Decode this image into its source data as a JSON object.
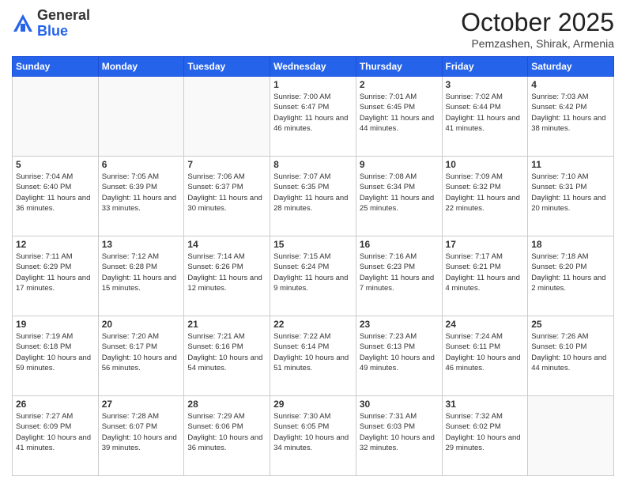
{
  "header": {
    "logo_general": "General",
    "logo_blue": "Blue",
    "month_title": "October 2025",
    "location": "Pemzashen, Shirak, Armenia"
  },
  "days_of_week": [
    "Sunday",
    "Monday",
    "Tuesday",
    "Wednesday",
    "Thursday",
    "Friday",
    "Saturday"
  ],
  "weeks": [
    [
      {
        "day": "",
        "info": ""
      },
      {
        "day": "",
        "info": ""
      },
      {
        "day": "",
        "info": ""
      },
      {
        "day": "1",
        "info": "Sunrise: 7:00 AM\nSunset: 6:47 PM\nDaylight: 11 hours and 46 minutes."
      },
      {
        "day": "2",
        "info": "Sunrise: 7:01 AM\nSunset: 6:45 PM\nDaylight: 11 hours and 44 minutes."
      },
      {
        "day": "3",
        "info": "Sunrise: 7:02 AM\nSunset: 6:44 PM\nDaylight: 11 hours and 41 minutes."
      },
      {
        "day": "4",
        "info": "Sunrise: 7:03 AM\nSunset: 6:42 PM\nDaylight: 11 hours and 38 minutes."
      }
    ],
    [
      {
        "day": "5",
        "info": "Sunrise: 7:04 AM\nSunset: 6:40 PM\nDaylight: 11 hours and 36 minutes."
      },
      {
        "day": "6",
        "info": "Sunrise: 7:05 AM\nSunset: 6:39 PM\nDaylight: 11 hours and 33 minutes."
      },
      {
        "day": "7",
        "info": "Sunrise: 7:06 AM\nSunset: 6:37 PM\nDaylight: 11 hours and 30 minutes."
      },
      {
        "day": "8",
        "info": "Sunrise: 7:07 AM\nSunset: 6:35 PM\nDaylight: 11 hours and 28 minutes."
      },
      {
        "day": "9",
        "info": "Sunrise: 7:08 AM\nSunset: 6:34 PM\nDaylight: 11 hours and 25 minutes."
      },
      {
        "day": "10",
        "info": "Sunrise: 7:09 AM\nSunset: 6:32 PM\nDaylight: 11 hours and 22 minutes."
      },
      {
        "day": "11",
        "info": "Sunrise: 7:10 AM\nSunset: 6:31 PM\nDaylight: 11 hours and 20 minutes."
      }
    ],
    [
      {
        "day": "12",
        "info": "Sunrise: 7:11 AM\nSunset: 6:29 PM\nDaylight: 11 hours and 17 minutes."
      },
      {
        "day": "13",
        "info": "Sunrise: 7:12 AM\nSunset: 6:28 PM\nDaylight: 11 hours and 15 minutes."
      },
      {
        "day": "14",
        "info": "Sunrise: 7:14 AM\nSunset: 6:26 PM\nDaylight: 11 hours and 12 minutes."
      },
      {
        "day": "15",
        "info": "Sunrise: 7:15 AM\nSunset: 6:24 PM\nDaylight: 11 hours and 9 minutes."
      },
      {
        "day": "16",
        "info": "Sunrise: 7:16 AM\nSunset: 6:23 PM\nDaylight: 11 hours and 7 minutes."
      },
      {
        "day": "17",
        "info": "Sunrise: 7:17 AM\nSunset: 6:21 PM\nDaylight: 11 hours and 4 minutes."
      },
      {
        "day": "18",
        "info": "Sunrise: 7:18 AM\nSunset: 6:20 PM\nDaylight: 11 hours and 2 minutes."
      }
    ],
    [
      {
        "day": "19",
        "info": "Sunrise: 7:19 AM\nSunset: 6:18 PM\nDaylight: 10 hours and 59 minutes."
      },
      {
        "day": "20",
        "info": "Sunrise: 7:20 AM\nSunset: 6:17 PM\nDaylight: 10 hours and 56 minutes."
      },
      {
        "day": "21",
        "info": "Sunrise: 7:21 AM\nSunset: 6:16 PM\nDaylight: 10 hours and 54 minutes."
      },
      {
        "day": "22",
        "info": "Sunrise: 7:22 AM\nSunset: 6:14 PM\nDaylight: 10 hours and 51 minutes."
      },
      {
        "day": "23",
        "info": "Sunrise: 7:23 AM\nSunset: 6:13 PM\nDaylight: 10 hours and 49 minutes."
      },
      {
        "day": "24",
        "info": "Sunrise: 7:24 AM\nSunset: 6:11 PM\nDaylight: 10 hours and 46 minutes."
      },
      {
        "day": "25",
        "info": "Sunrise: 7:26 AM\nSunset: 6:10 PM\nDaylight: 10 hours and 44 minutes."
      }
    ],
    [
      {
        "day": "26",
        "info": "Sunrise: 7:27 AM\nSunset: 6:09 PM\nDaylight: 10 hours and 41 minutes."
      },
      {
        "day": "27",
        "info": "Sunrise: 7:28 AM\nSunset: 6:07 PM\nDaylight: 10 hours and 39 minutes."
      },
      {
        "day": "28",
        "info": "Sunrise: 7:29 AM\nSunset: 6:06 PM\nDaylight: 10 hours and 36 minutes."
      },
      {
        "day": "29",
        "info": "Sunrise: 7:30 AM\nSunset: 6:05 PM\nDaylight: 10 hours and 34 minutes."
      },
      {
        "day": "30",
        "info": "Sunrise: 7:31 AM\nSunset: 6:03 PM\nDaylight: 10 hours and 32 minutes."
      },
      {
        "day": "31",
        "info": "Sunrise: 7:32 AM\nSunset: 6:02 PM\nDaylight: 10 hours and 29 minutes."
      },
      {
        "day": "",
        "info": ""
      }
    ]
  ]
}
